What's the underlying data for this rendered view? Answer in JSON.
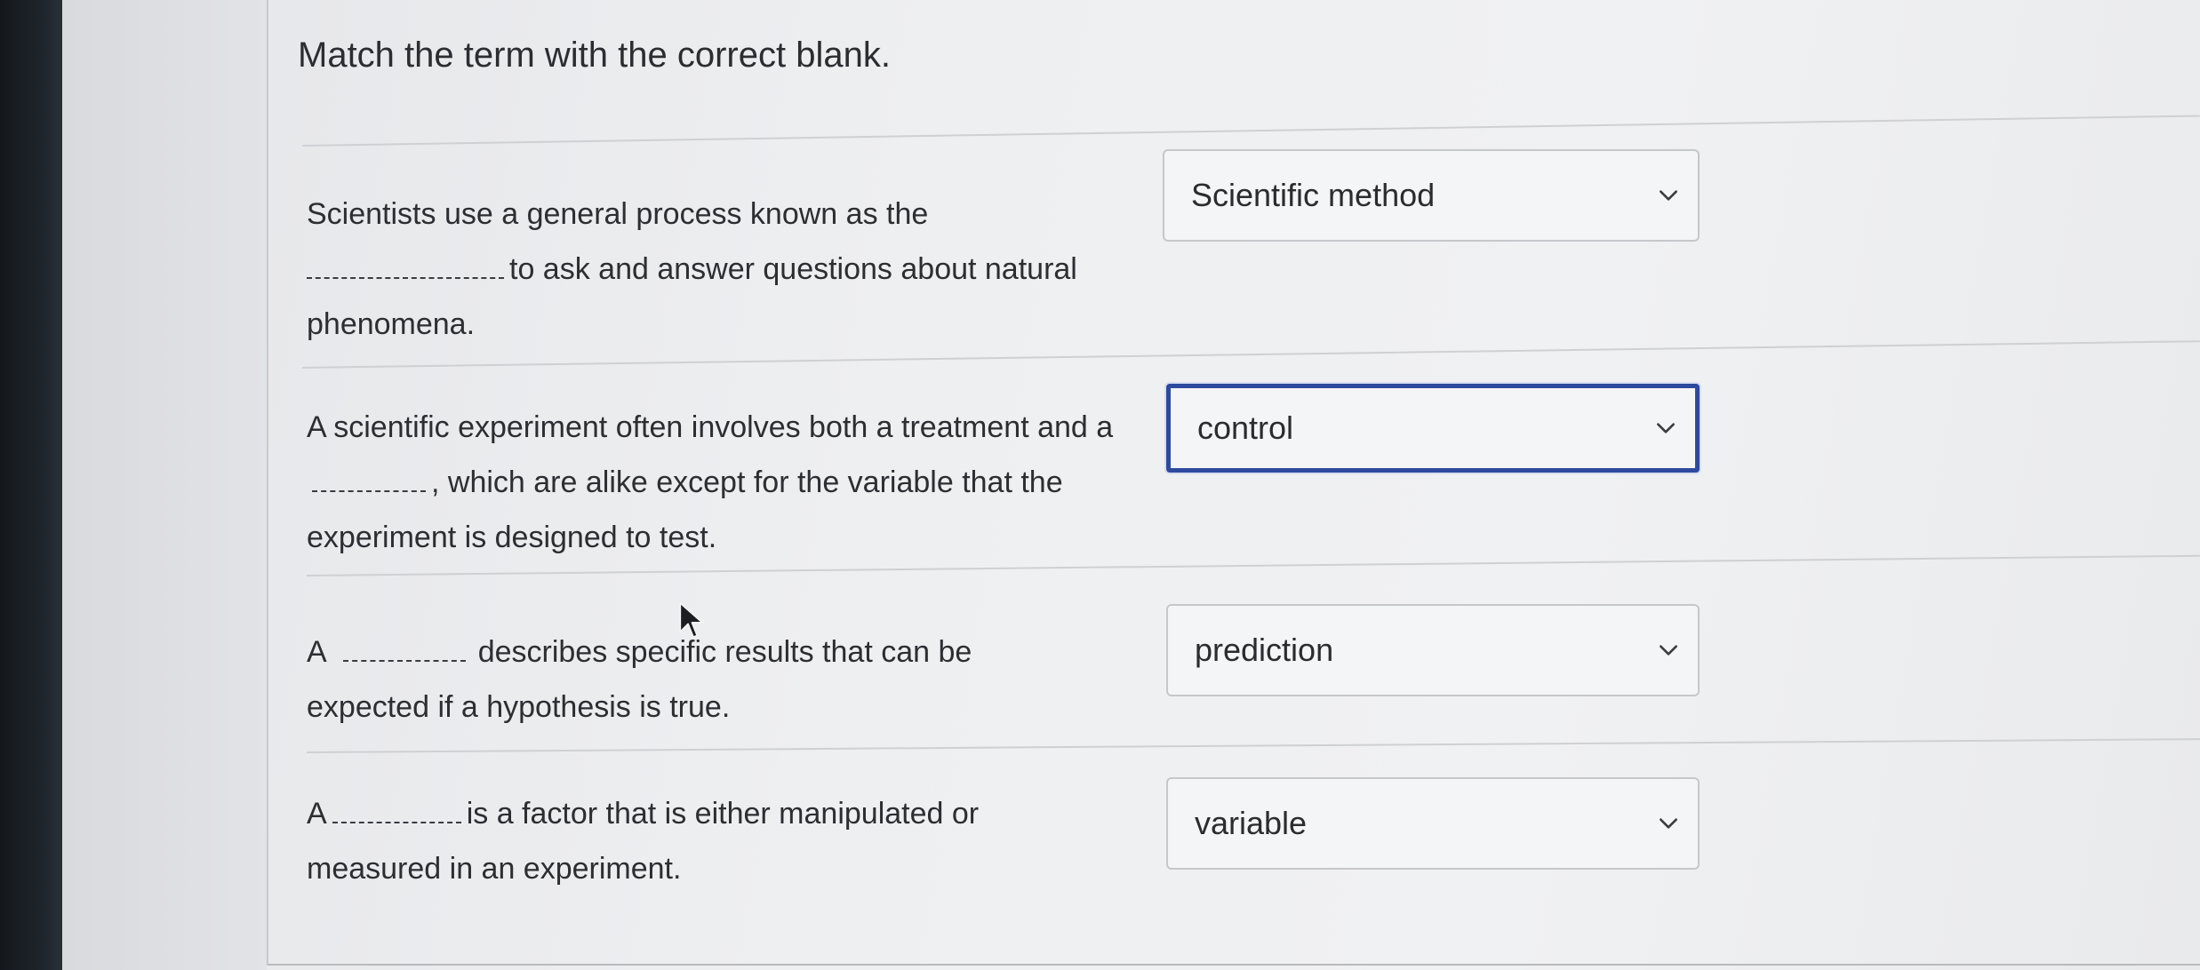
{
  "question": {
    "title": "Match the term with the correct blank."
  },
  "items": [
    {
      "prompt_before": "Scientists use a general process known as the",
      "prompt_after": "to ask and answer questions about natural phenomena.",
      "selected": "Scientific method",
      "focused": false
    },
    {
      "prompt_before": "A scientific experiment often involves both a treatment and a",
      "prompt_after": ", which are alike except for the variable that the experiment is designed to test.",
      "selected": "control",
      "focused": true
    },
    {
      "prompt_before": "A",
      "prompt_after": "describes specific results that can be expected if a hypothesis is true.",
      "selected": "prediction",
      "focused": false
    },
    {
      "prompt_before": "A",
      "prompt_after": "is a factor that is either manipulated or measured in an experiment.",
      "selected": "variable",
      "focused": false
    }
  ],
  "icons": {
    "dropdown": "chevron-down-icon",
    "cursor": "mouse-pointer-icon"
  },
  "colors": {
    "focus_border": "#2d4a9e",
    "text": "#2a2c30"
  }
}
